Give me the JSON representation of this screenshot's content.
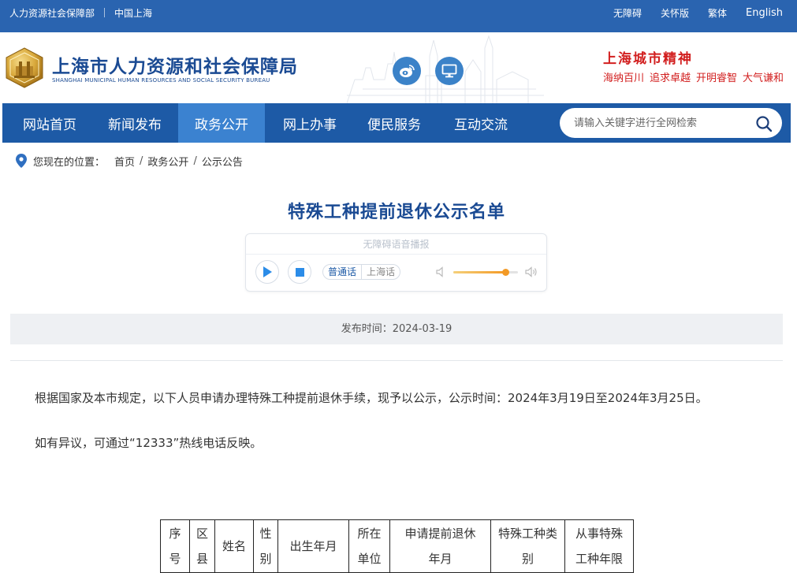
{
  "topbar": {
    "org": "人力资源社会保障部",
    "region": "中国上海",
    "links": [
      "无障碍",
      "关怀版",
      "繁体",
      "English"
    ]
  },
  "header": {
    "logo_cn": "上海市人力资源和社会保障局",
    "logo_en": "SHANGHAI MUNICIPAL HUMAN RESOURCES AND SOCIAL SECURITY BUREAU",
    "spirit_title": "上海城市精神",
    "spirit_words": [
      "海纳百川",
      "追求卓越",
      "开明睿智",
      "大气谦和"
    ],
    "icons": [
      "weibo-icon",
      "monitor-icon"
    ]
  },
  "nav": {
    "items": [
      "网站首页",
      "新闻发布",
      "政务公开",
      "网上办事",
      "便民服务",
      "互动交流"
    ],
    "active_index": 2,
    "search_placeholder": "请输入关键字进行全网检索"
  },
  "breadcrumb": {
    "label": "您现在的位置：",
    "items": [
      "首页",
      "政务公开",
      "公示公告"
    ]
  },
  "article": {
    "title": "特殊工种提前退休公示名单",
    "publish": "发布时间：2024-03-19",
    "paragraphs": [
      "根据国家及本市规定，以下人员申请办理特殊工种提前退休手续，现予以公示，公示时间：2024年3月19日至2024年3月25日。",
      "如有异议，可通过“12333”热线电话反映。"
    ]
  },
  "player": {
    "header": "无障碍语音播报",
    "lang_on": "普通话",
    "lang_off": "上海话",
    "volume_percent": 80
  },
  "table": {
    "headers": [
      [
        "序",
        "号"
      ],
      [
        "区",
        "县"
      ],
      [
        "姓名"
      ],
      [
        "性",
        "别"
      ],
      [
        "出生年月"
      ],
      [
        "所在",
        "单位"
      ],
      [
        "申请提前退休",
        "年月"
      ],
      [
        "特殊工种类",
        "别"
      ],
      [
        "从事特殊",
        "工种年限"
      ]
    ]
  },
  "colors": {
    "topbar": "#2a64b0",
    "nav": "#1d5aa6",
    "nav_active": "#3b82d0",
    "title": "#1a4a93",
    "spirit": "#d21f1f"
  }
}
